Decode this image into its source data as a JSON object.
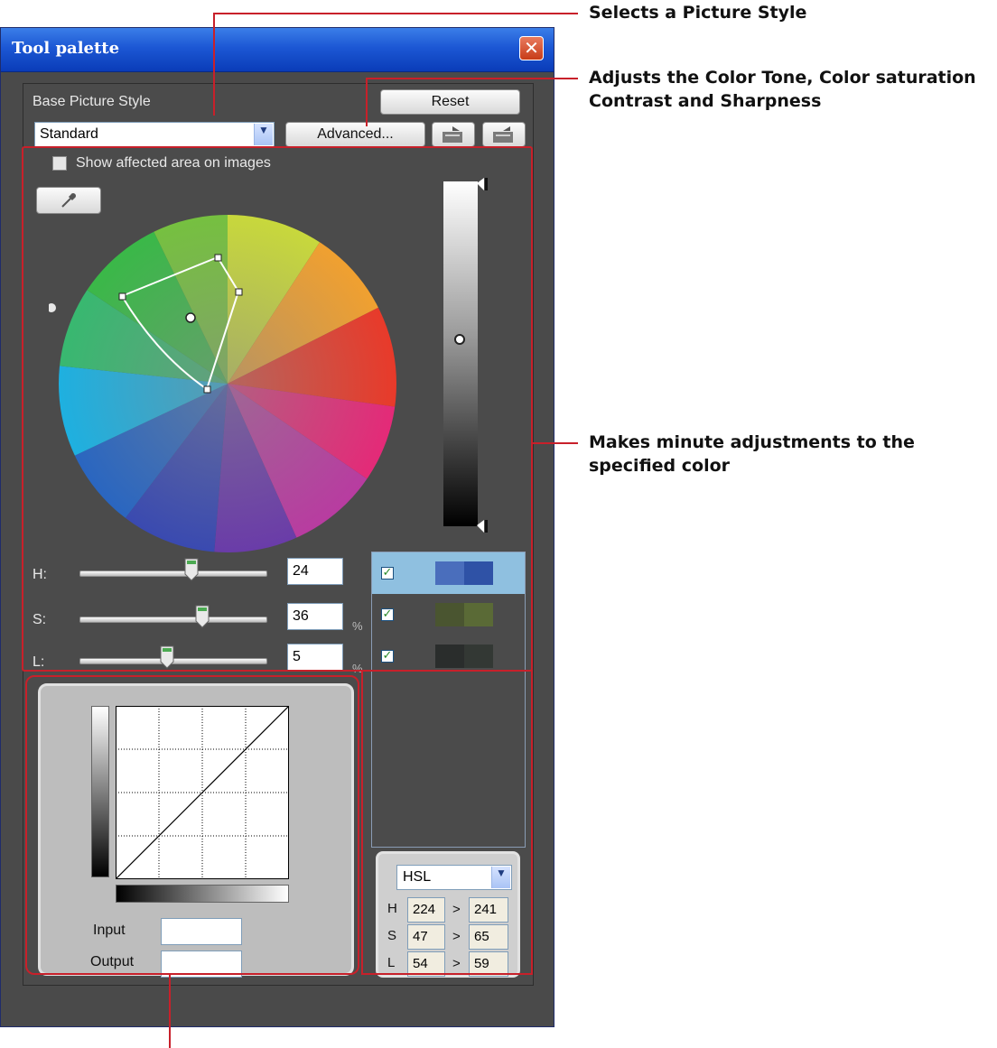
{
  "window": {
    "title": "Tool palette",
    "close_glyph": "✕"
  },
  "picture_style": {
    "label": "Base Picture Style",
    "selected": "Standard",
    "reset_label": "Reset",
    "advanced_label": "Advanced...",
    "open_icon": "open-file-icon",
    "save_icon": "save-file-icon"
  },
  "color_adjust": {
    "show_affected_label": "Show affected area on images",
    "show_affected_checked": false,
    "eyedropper_icon": "eyedropper-icon",
    "h_label": "H:",
    "h_value": "24",
    "s_label": "S:",
    "s_value": "36",
    "s_unit": "%",
    "l_label": "L:",
    "l_value": "5",
    "l_unit": "%",
    "slider_h_fraction": 0.6,
    "slider_s_fraction": 0.66,
    "slider_l_fraction": 0.47
  },
  "color_list": [
    {
      "checked": true,
      "selected": true,
      "before": "#4a6ebc",
      "after": "#2f52a6"
    },
    {
      "checked": true,
      "selected": false,
      "before": "#4a5530",
      "after": "#5a6a36"
    },
    {
      "checked": true,
      "selected": false,
      "before": "#2a2d2c",
      "after": "#333834"
    }
  ],
  "curve": {
    "input_label": "Input",
    "output_label": "Output",
    "input_value": "",
    "output_value": ""
  },
  "hsl_panel": {
    "mode": "HSL",
    "rows": [
      {
        "label": "H",
        "from": "224",
        "to": "241"
      },
      {
        "label": "S",
        "from": "47",
        "to": "65"
      },
      {
        "label": "L",
        "from": "54",
        "to": "59"
      }
    ],
    "arrow": ">"
  },
  "annotations": {
    "picture_style": "Selects a Picture Style",
    "advanced_line1": "Adjusts the Color Tone, Color saturation",
    "advanced_line2": "Contrast and Sharpness",
    "minute_line1": "Makes minute adjustments to the",
    "minute_line2": "specified color",
    "color": "#c8202a"
  }
}
